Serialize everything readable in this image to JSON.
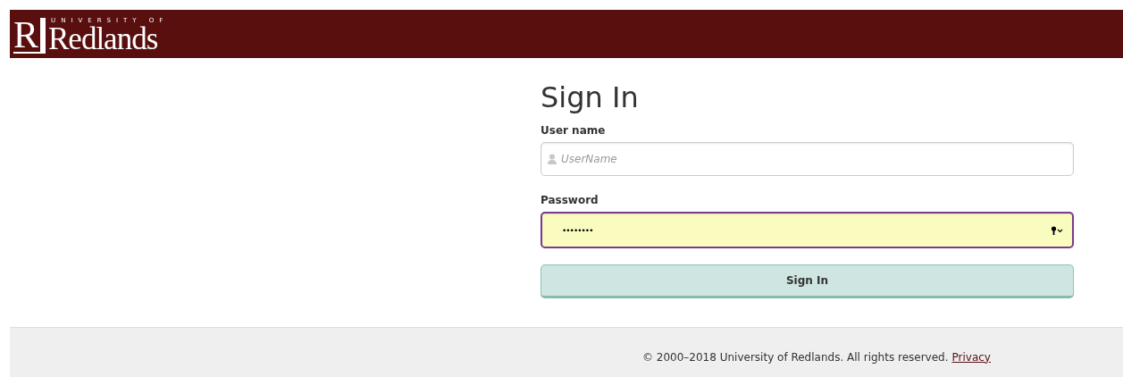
{
  "header": {
    "logo": {
      "mark": "R",
      "top": "UNIVERSITY OF",
      "name": "Redlands"
    }
  },
  "form": {
    "title": "Sign In",
    "fields": [
      {
        "kind": "text",
        "label": "User name",
        "placeholder": "UserName",
        "focused": false,
        "autofilled": false
      },
      {
        "kind": "password",
        "label": "Password",
        "value": "••••••••",
        "focused": true,
        "autofilled": true
      }
    ],
    "submit": "Sign In"
  },
  "footer": {
    "copyright": "© 2000–2018 University of Redlands. All rights reserved.",
    "link": "Privacy"
  }
}
